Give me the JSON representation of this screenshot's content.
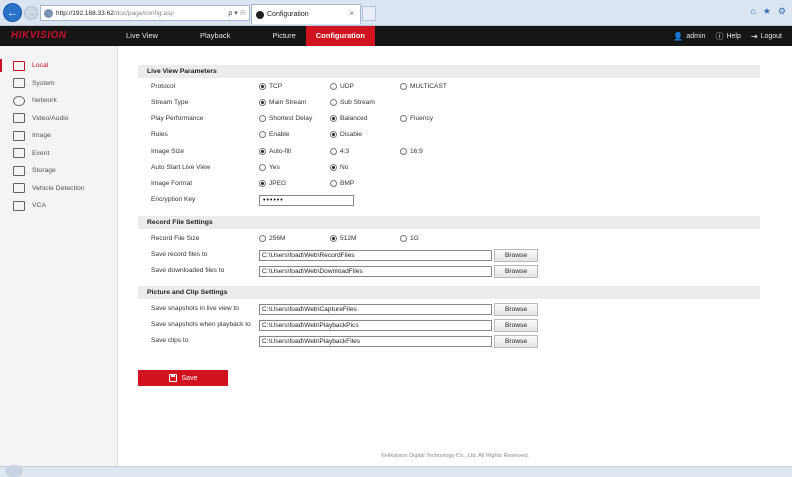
{
  "browser": {
    "url_host": "http://192.168.33.62",
    "url_path": "/doc/page/config.asp",
    "address_tools": "ρ ▾ ☉",
    "tab_title": "Configuration",
    "tab_close": "×",
    "back_glyph": "←",
    "forward_glyph": "→",
    "chrome_icons": [
      "home-icon",
      "star-icon",
      "gear-icon"
    ]
  },
  "app": {
    "logo": "HIKVISION",
    "nav": [
      {
        "label": "Live View",
        "active": false
      },
      {
        "label": "Playback",
        "active": false
      },
      {
        "label": "Picture",
        "active": false
      },
      {
        "label": "Configuration",
        "active": true
      }
    ],
    "user": {
      "name": "admin",
      "help": "Help",
      "logout": "Logout"
    },
    "accent_color": "#d1131f"
  },
  "sidebar": {
    "items": [
      {
        "label": "Local",
        "icon": "monitor-icon",
        "active": true
      },
      {
        "label": "System",
        "icon": "system-icon",
        "active": false
      },
      {
        "label": "Network",
        "icon": "network-icon",
        "active": false
      },
      {
        "label": "Video/Audio",
        "icon": "video-audio-icon",
        "active": false
      },
      {
        "label": "Image",
        "icon": "image-icon",
        "active": false
      },
      {
        "label": "Event",
        "icon": "calendar-icon",
        "active": false
      },
      {
        "label": "Storage",
        "icon": "storage-icon",
        "active": false
      },
      {
        "label": "Vehicle Detection",
        "icon": "vehicle-icon",
        "active": false
      },
      {
        "label": "VCA",
        "icon": "vca-icon",
        "active": false
      }
    ]
  },
  "live_view": {
    "title": "Live View Parameters",
    "protocol": {
      "label": "Protocol",
      "options": [
        "TCP",
        "UDP",
        "MULTICAST"
      ],
      "selected": "TCP"
    },
    "stream_type": {
      "label": "Stream Type",
      "options": [
        "Main Stream",
        "Sub Stream"
      ],
      "selected": "Main Stream"
    },
    "play_performance": {
      "label": "Play Performance",
      "options": [
        "Shortest Delay",
        "Balanced",
        "Fluency"
      ],
      "selected": "Balanced"
    },
    "rules": {
      "label": "Rules",
      "options": [
        "Enable",
        "Disable"
      ],
      "selected": "Disable"
    },
    "image_size": {
      "label": "Image Size",
      "options": [
        "Auto-fill",
        "4:3",
        "16:9"
      ],
      "selected": "Auto-fill"
    },
    "auto_start": {
      "label": "Auto Start Live View",
      "options": [
        "Yes",
        "No"
      ],
      "selected": "No"
    },
    "image_format": {
      "label": "Image Format",
      "options": [
        "JPEG",
        "BMP"
      ],
      "selected": "JPEG"
    },
    "encryption_key": {
      "label": "Encryption Key",
      "value": "••••••"
    }
  },
  "record": {
    "title": "Record File Settings",
    "file_size": {
      "label": "Record File Size",
      "options": [
        "256M",
        "512M",
        "1G"
      ],
      "selected": "512M"
    },
    "save_record": {
      "label": "Save record files to",
      "value": "C:\\Users\\foad\\Web\\RecordFiles"
    },
    "save_download": {
      "label": "Save downloaded files to",
      "value": "C:\\Users\\foad\\Web\\DownloadFiles"
    }
  },
  "picture": {
    "title": "Picture and Clip Settings",
    "snap_live": {
      "label": "Save snapshots in live view to",
      "value": "C:\\Users\\foad\\Web\\CaptureFiles"
    },
    "snap_playback": {
      "label": "Save snapshots when playback to",
      "value": "C:\\Users\\foad\\Web\\PlaybackPics"
    },
    "clips": {
      "label": "Save clips to",
      "value": "C:\\Users\\foad\\Web\\PlaybackFiles"
    }
  },
  "buttons": {
    "browse": "Browse",
    "save": "Save"
  },
  "footer": "©Hikvision Digital Technology Co., Ltd. All Rights Reserved."
}
